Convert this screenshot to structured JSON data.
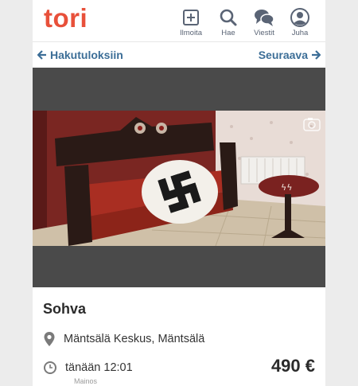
{
  "header": {
    "logo": "tori",
    "brand_color": "#e8503a",
    "nav": [
      {
        "label": "Ilmoita",
        "icon": "plus-box-icon"
      },
      {
        "label": "Hae",
        "icon": "search-icon"
      },
      {
        "label": "Viestit",
        "icon": "chat-bubbles-icon"
      },
      {
        "label": "Juha",
        "icon": "user-icon"
      }
    ]
  },
  "subnav": {
    "back_label": "Hakutuloksiin",
    "next_label": "Seuraava",
    "link_color": "#3c6e97"
  },
  "listing": {
    "title": "Sohva",
    "location": "Mäntsälä Keskus, Mäntsälä",
    "time": "tänään 12:01",
    "price": "490 €",
    "ad_label": "Mainos",
    "image_icon": "zoom-image-icon"
  }
}
